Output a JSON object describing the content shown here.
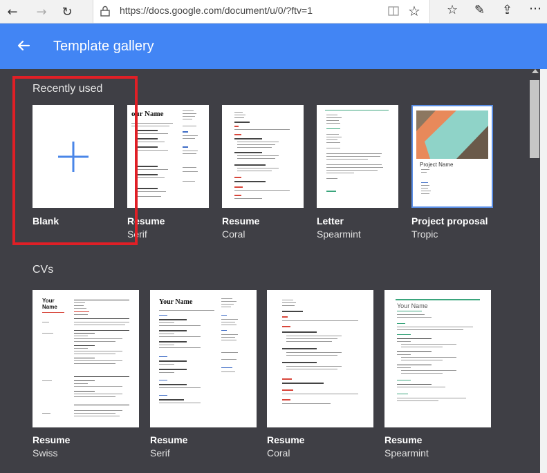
{
  "browser": {
    "url": "https://docs.google.com/document/u/0/?ftv=1"
  },
  "header": {
    "title": "Template gallery"
  },
  "sections": {
    "recent": {
      "title": "Recently used",
      "tiles": [
        {
          "name": "Blank",
          "sub": ""
        },
        {
          "name": "Resume",
          "sub": "Serif"
        },
        {
          "name": "Resume",
          "sub": "Coral"
        },
        {
          "name": "Letter",
          "sub": "Spearmint"
        },
        {
          "name": "Project proposal",
          "sub": "Tropic"
        }
      ]
    },
    "cvs": {
      "title": "CVs",
      "tiles": [
        {
          "name": "Resume",
          "sub": "Swiss"
        },
        {
          "name": "Resume",
          "sub": "Serif"
        },
        {
          "name": "Resume",
          "sub": "Coral"
        },
        {
          "name": "Resume",
          "sub": "Spearmint"
        }
      ]
    }
  },
  "thumb_text": {
    "your_name": "Your Name",
    "your": "Your",
    "name": "Name",
    "your_name_partial": "our Name",
    "project_name": "Project Name"
  },
  "colors": {
    "header_blue": "#4285f4",
    "background": "#3f3f45",
    "highlight_red": "#e01f26",
    "plus_blue": "#4a86e8"
  }
}
